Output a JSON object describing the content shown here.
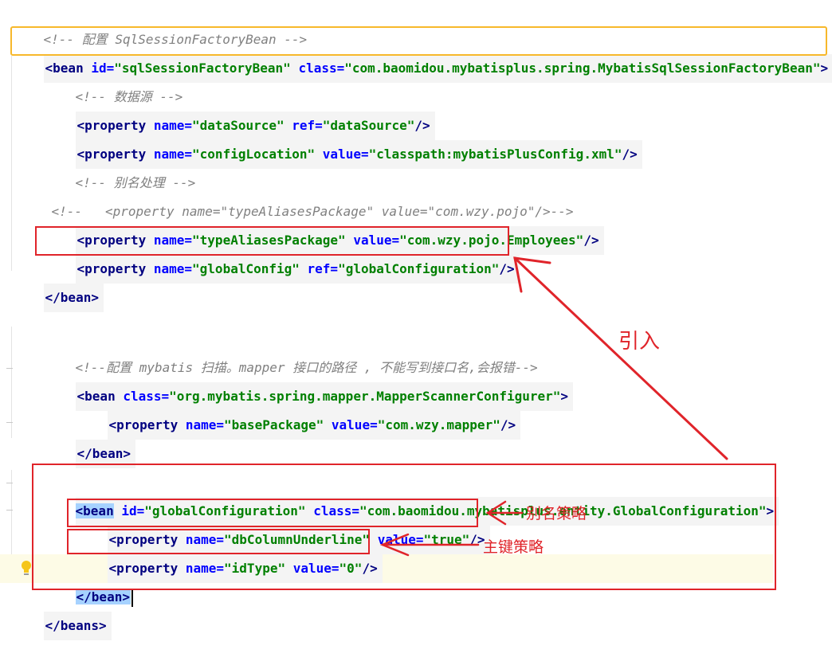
{
  "code": {
    "comment_config_factory": "<!-- 配置 SqlSessionFactoryBean -->",
    "factory_bean_open": {
      "tag_start": "<bean ",
      "id_attr": "id=",
      "id_val": "\"sqlSessionFactoryBean\"",
      "class_attr": "class=",
      "class_val": "\"com.baomidou.mybatisplus.spring.MybatisSqlSessionFactoryBean\"",
      "tag_end": ">"
    },
    "comment_datasource": "<!-- 数据源 -->",
    "prop_datasource": {
      "start": "<property ",
      "a1": "name=",
      "v1": "\"dataSource\"",
      "a2": "ref=",
      "v2": "\"dataSource\"",
      "end": "/>"
    },
    "prop_configlocation": {
      "start": "<property ",
      "a1": "name=",
      "v1": "\"configLocation\"",
      "a2": "value=",
      "v2": "\"classpath:mybatisPlusConfig.xml\"",
      "end": "/>"
    },
    "comment_alias": "<!-- 别名处理 -->",
    "comment_alias_commented_out": "<!--   <property name=\"typeAliasesPackage\" value=\"com.wzy.pojo\"/>-->",
    "prop_typealiases": {
      "start": "<property ",
      "a1": "name=",
      "v1": "\"typeAliasesPackage\"",
      "a2": "value=",
      "v2": "\"com.wzy.pojo.Employees\"",
      "end": "/>"
    },
    "prop_globalconfig": {
      "start": "<property ",
      "a1": "name=",
      "v1": "\"globalConfig\"",
      "a2": "ref=",
      "v2": "\"globalConfiguration\"",
      "end": "/>"
    },
    "factory_bean_close": "</bean>",
    "comment_mapper_scan": "<!--配置 mybatis 扫描。mapper 接口的路径 , 不能写到接口名,会报错-->",
    "mapper_bean_open": {
      "start": "<bean ",
      "a1": "class=",
      "v1": "\"org.mybatis.spring.mapper.MapperScannerConfigurer\"",
      "end": ">"
    },
    "prop_basepackage": {
      "start": "<property ",
      "a1": "name=",
      "v1": "\"basePackage\"",
      "a2": "value=",
      "v2": "\"com.wzy.mapper\"",
      "end": "/>"
    },
    "mapper_bean_close": "</bean>",
    "global_bean_open": {
      "tag_start": "<bean",
      "id_attr": "id=",
      "id_val": "\"globalConfiguration\"",
      "class_attr": "class=",
      "class_val": "\"com.baomidou.mybatisplus.entity.GlobalConfiguration\"",
      "tag_end": ">"
    },
    "prop_dbcolumn": {
      "start": "<property ",
      "a1": "name=",
      "v1": "\"dbColumnUnderline\"",
      "a2": "value=",
      "v2": "\"true\"",
      "end": "/>"
    },
    "prop_idtype": {
      "start": "<property ",
      "a1": "name=",
      "v1": "\"idType\"",
      "a2": "value=",
      "v2": "\"0\"",
      "end": "/>"
    },
    "global_bean_close": "</bean>",
    "beans_close": "</beans>"
  },
  "annotations": {
    "import_label": "引入",
    "alias_strategy": "别名策略",
    "key_strategy": "主键策略"
  },
  "colors": {
    "tag": "#000080",
    "attribute": "#0000ff",
    "value": "#008000",
    "comment": "#808080",
    "annotation": "#e0242a",
    "highlight_box": "#f7b82b",
    "selection": "#a6d2ff"
  }
}
